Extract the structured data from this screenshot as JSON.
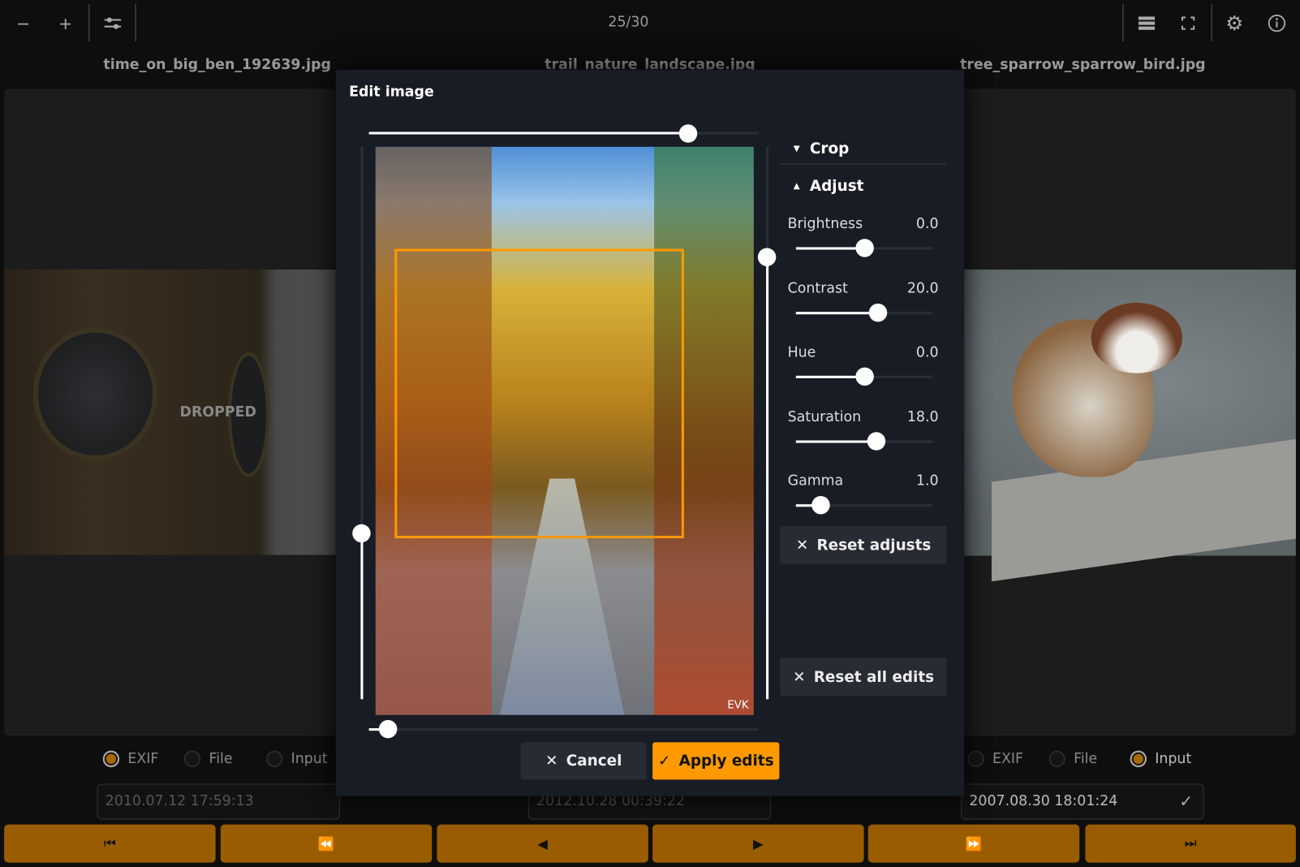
{
  "toolbar": {
    "counter": "25/30",
    "zoom_out": "−",
    "zoom_in": "+"
  },
  "filenames": [
    "time_on_big_ben_192639.jpg",
    "trail_nature_landscape.jpg",
    "tree_sparrow_sparrow_bird.jpg"
  ],
  "left_panel": {
    "overlay": "DROPPED"
  },
  "date_sources": {
    "options": [
      "EXIF",
      "File",
      "Input"
    ],
    "left_selected": "EXIF",
    "right_selected": "Input"
  },
  "dates": [
    "2010.07.12 17:59:13",
    "2012.10.28 00:39:22",
    "2007.08.30 18:01:24"
  ],
  "nav_icons": [
    "first-icon",
    "rewind-icon",
    "previous-icon",
    "next-icon",
    "fast-forward-icon",
    "last-icon"
  ],
  "dialog": {
    "title": "Edit image",
    "crop_section": "Crop",
    "adjust_section": "Adjust",
    "adjustments": [
      {
        "label": "Brightness",
        "value": "0.0",
        "num": 0,
        "min": -100,
        "max": 100
      },
      {
        "label": "Contrast",
        "value": "20.0",
        "num": 20,
        "min": -100,
        "max": 100
      },
      {
        "label": "Hue",
        "value": "0.0",
        "num": 0,
        "min": -100,
        "max": 100
      },
      {
        "label": "Saturation",
        "value": "18.0",
        "num": 18,
        "min": -100,
        "max": 100
      },
      {
        "label": "Gamma",
        "value": "1.0",
        "num": 1,
        "min": 0.1,
        "max": 5
      }
    ],
    "reset_adjusts": "Reset adjusts",
    "reset_all": "Reset all edits",
    "cancel": "Cancel",
    "apply": "Apply edits",
    "watermark": "EVK"
  },
  "colors": {
    "accent": "#ff9900",
    "nav": "#9a5c00",
    "crop_rect": "#ff9900"
  }
}
